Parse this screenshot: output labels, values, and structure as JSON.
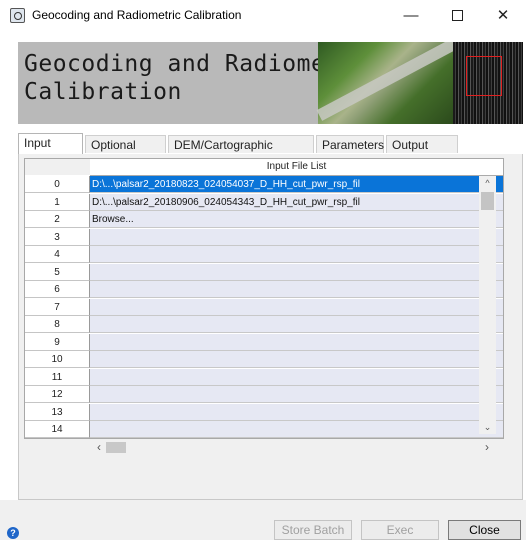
{
  "window": {
    "title": "Geocoding and Radiometric Calibration",
    "controls": {
      "minimize": "—",
      "close": "✕"
    }
  },
  "banner": {
    "title": "Geocoding and Radiometric\nCalibration"
  },
  "tabs": [
    {
      "label": "Input Files",
      "active": true
    },
    {
      "label": "Optional Files"
    },
    {
      "label": "DEM/Cartographic System"
    },
    {
      "label": "Parameters"
    },
    {
      "label": "Output Files"
    }
  ],
  "table": {
    "column_header": "Input File List",
    "rows": [
      {
        "index": "0",
        "value": "D:\\...\\palsar2_20180823_024054037_D_HH_cut_pwr_rsp_fil",
        "selected": true
      },
      {
        "index": "1",
        "value": "D:\\...\\palsar2_20180906_024054343_D_HH_cut_pwr_rsp_fil"
      },
      {
        "index": "2",
        "value": "Browse..."
      },
      {
        "index": "3",
        "value": ""
      },
      {
        "index": "4",
        "value": ""
      },
      {
        "index": "5",
        "value": ""
      },
      {
        "index": "6",
        "value": ""
      },
      {
        "index": "7",
        "value": ""
      },
      {
        "index": "8",
        "value": ""
      },
      {
        "index": "9",
        "value": ""
      },
      {
        "index": "10",
        "value": ""
      },
      {
        "index": "11",
        "value": ""
      },
      {
        "index": "12",
        "value": ""
      },
      {
        "index": "13",
        "value": ""
      },
      {
        "index": "14",
        "value": ""
      }
    ]
  },
  "buttons": {
    "store_batch": "Store Batch",
    "exec": "Exec",
    "close": "Close"
  },
  "help": "?",
  "colors": {
    "selection": "#0a74d8",
    "cell_bg": "#e6e8f3",
    "help": "#1f66c9"
  }
}
